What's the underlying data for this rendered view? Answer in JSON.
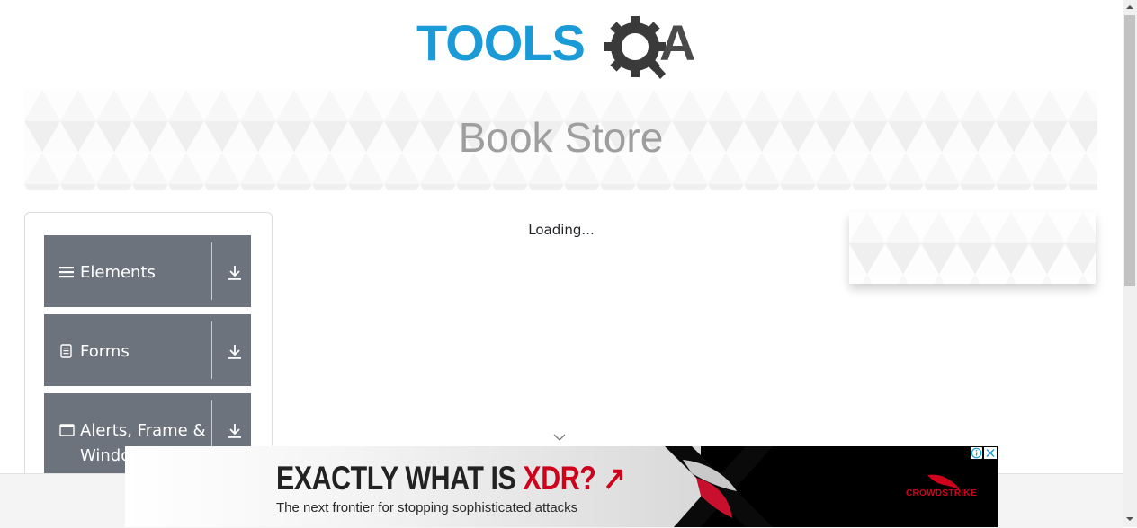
{
  "header": {
    "logo_text_main": "TOOLS",
    "logo_text_end": "A",
    "logo_colors": {
      "tools": "#1a9ad6",
      "qa": "#4a4a4a"
    }
  },
  "banner": {
    "title": "Book Store"
  },
  "sidebar": {
    "groups": [
      {
        "label": "Elements",
        "icon": "hamburger-icon"
      },
      {
        "label": "Forms",
        "icon": "document-icon"
      },
      {
        "label": "Alerts, Frame & Windows",
        "icon": "window-icon"
      }
    ],
    "group_color": "#6c737c"
  },
  "main": {
    "loading_text": "Loading..."
  },
  "ad": {
    "headline_prefix": "EXACTLY WHAT IS ",
    "headline_highlight": "XDR?",
    "headline_arrow": "↗",
    "subtext": "The next frontier for stopping sophisticated attacks",
    "brand": "CROWDSTRIKE",
    "info_glyph": "ⓘ",
    "close_glyph": "✕",
    "accent_color": "#d0021b"
  }
}
